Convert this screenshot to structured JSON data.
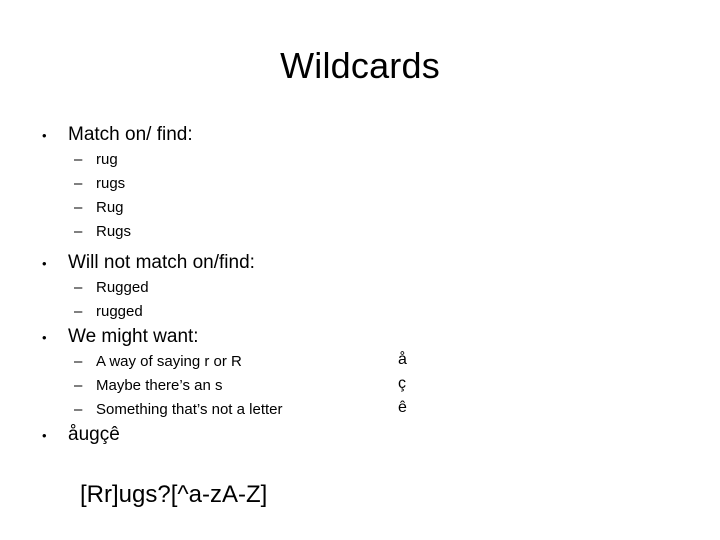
{
  "slide": {
    "title": "Wildcards",
    "background_color": "#ffffff",
    "text_color": "#000000",
    "bullet_marker": "•",
    "dash_marker": "–",
    "sections": [
      {
        "heading": "Match on/ find:",
        "items": [
          "rug",
          "rugs",
          "Rug",
          "Rugs"
        ]
      },
      {
        "heading": "Will not match on/find:",
        "items": [
          "Rugged",
          "rugged"
        ]
      },
      {
        "heading": "We might want:",
        "items": [
          "A way of saying r or R",
          "Maybe there’s an s",
          "Something that’s not a letter"
        ]
      }
    ],
    "glyph_column": [
      "å",
      "ç",
      "ê"
    ],
    "final_bullet": "åugçê",
    "code_line": "[Rr]ugs?[^a-zA-Z]"
  }
}
